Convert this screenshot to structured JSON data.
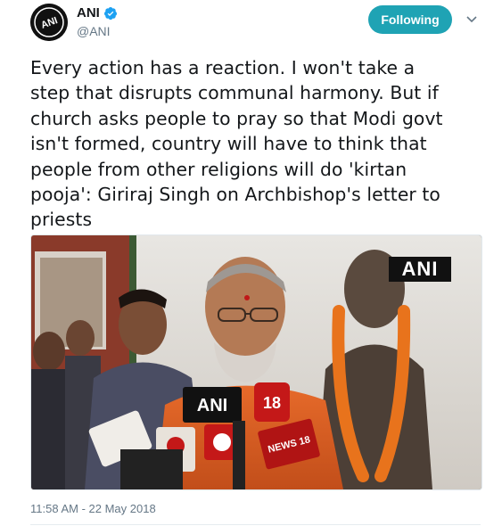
{
  "author": {
    "display_name": "ANI",
    "handle": "@ANI",
    "verified": true,
    "avatar_text": "ANI"
  },
  "follow_button": {
    "label": "Following"
  },
  "tweet": {
    "lines": [
      "Every action has a reaction. I won't take a",
      "step that disrupts communal harmony. But if",
      "church asks people to pray so that Modi govt",
      "isn't formed, country will have to think that",
      "people from other religions will do 'kirtan",
      "pooja': Giriraj Singh on Archbishop's letter to",
      "priests"
    ]
  },
  "media": {
    "watermark": "ANI",
    "mic_labels": [
      "ANI",
      "18",
      "NEWS 18"
    ]
  },
  "timestamp": "11:58 AM - 22 May 2018",
  "colors": {
    "follow_bg": "#1fa3b4",
    "verified": "#1da1f2",
    "text": "#14171a",
    "muted": "#657786"
  },
  "icons": [
    "verified-badge-icon",
    "chevron-down-icon"
  ]
}
